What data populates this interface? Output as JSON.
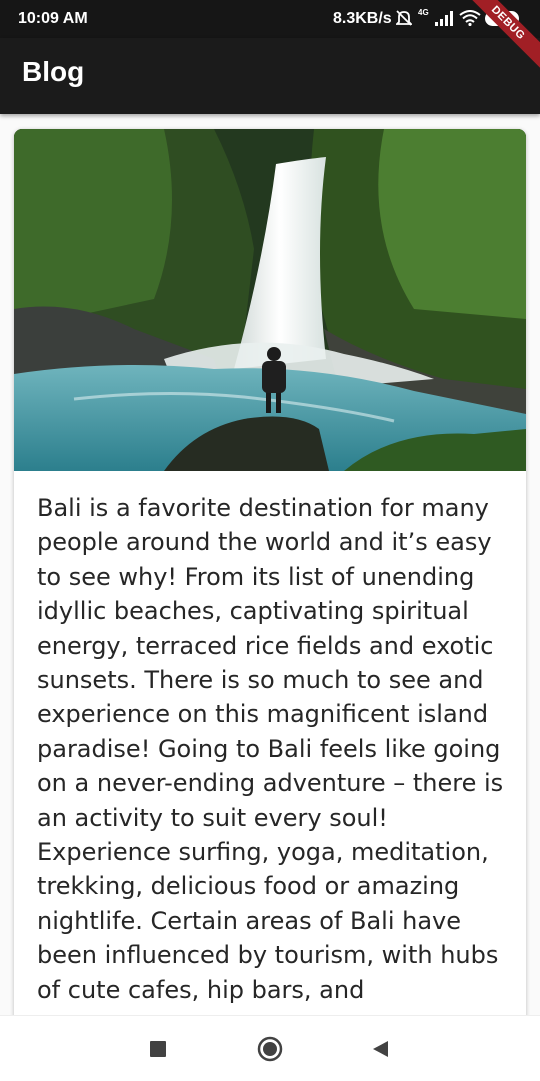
{
  "status_bar": {
    "time": "10:09 AM",
    "network_speed": "8.3KB/s",
    "network_type": "4G",
    "battery_level": "44",
    "icons": [
      "mute-icon",
      "signal-icon",
      "wifi-icon",
      "battery-icon"
    ]
  },
  "debug_banner": "DEBUG",
  "app_bar": {
    "title": "Blog"
  },
  "post": {
    "image_icon": "waterfall-photo",
    "body": "Bali is a favorite destination for many people around the world and it’s easy to see why! From its list of unending idyllic beaches, captivating spiritual energy, terraced rice fields and exotic sunsets. There is so much to see and experience on this magnificent island paradise! Going to Bali feels like going on a never-ending adventure – there is an activity to suit every soul! Experience surfing, yoga, meditation, trekking, delicious food or amazing nightlife. Certain areas of Bali have been influenced by tourism, with hubs of cute cafes, hip bars, and"
  },
  "nav_bar": {
    "buttons": [
      "recents-icon",
      "home-icon",
      "back-icon"
    ]
  },
  "colors": {
    "app_bar": "#1b1b1b",
    "status_bar": "#161616",
    "debug_ribbon": "#a11f25",
    "card": "#ffffff",
    "text": "#262626"
  }
}
